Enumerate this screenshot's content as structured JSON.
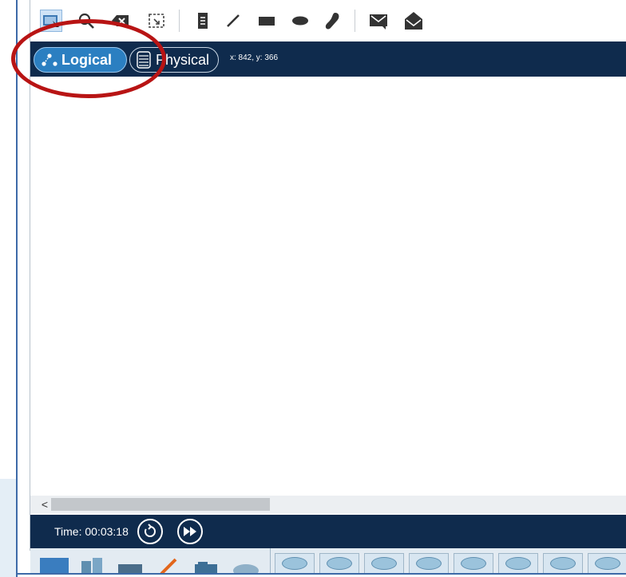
{
  "toolbar": {
    "tools": [
      {
        "icon": "select-tool-icon"
      },
      {
        "icon": "inspect-magnify-icon"
      },
      {
        "icon": "delete-tool-icon"
      },
      {
        "icon": "resize-tool-icon"
      },
      {
        "icon": "note-tool-icon"
      },
      {
        "icon": "draw-line-icon"
      },
      {
        "icon": "draw-rectangle-icon"
      },
      {
        "icon": "draw-ellipse-icon"
      },
      {
        "icon": "freeform-draw-icon"
      },
      {
        "icon": "add-simple-pdu-icon"
      },
      {
        "icon": "add-complex-pdu-icon"
      }
    ]
  },
  "nav": {
    "logical_label": "Logical",
    "physical_label": "Physical",
    "coords": "x: 842, y: 366"
  },
  "scrollbar": {
    "left_arrow": "<"
  },
  "time": {
    "label": "Time: 00:03:18"
  },
  "colors": {
    "nav_bg": "#0f2b4d",
    "logical_pill": "#2b7fc1",
    "annotation": "#b81414"
  }
}
